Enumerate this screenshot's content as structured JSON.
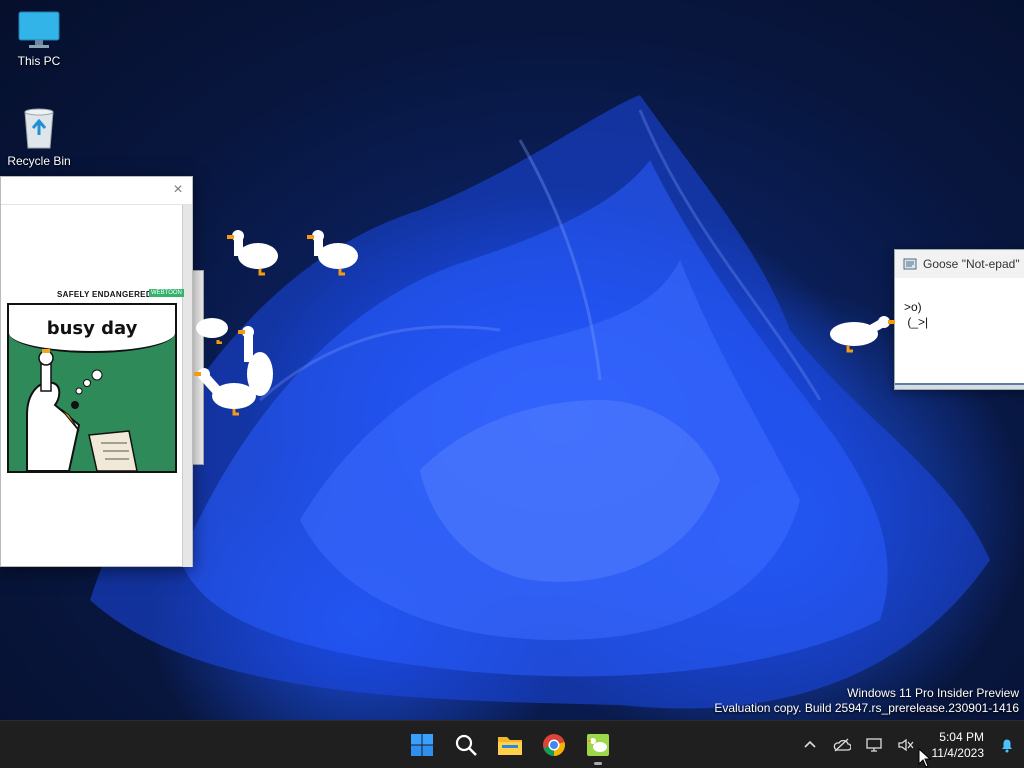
{
  "desktop": {
    "icons": [
      {
        "label": "This PC",
        "icon": "monitor-icon"
      },
      {
        "label": "Recycle Bin",
        "icon": "recycle-bin-icon"
      }
    ]
  },
  "comic_window": {
    "close_glyph": "×",
    "header": "SAFELY ENDANGERED",
    "badge": "WEBTOON",
    "caption": "busy day"
  },
  "notepad": {
    "title": "Goose \"Not-epad\"",
    "body": ">o)\n (_>|"
  },
  "watermark": {
    "line1": "Windows 11 Pro Insider Preview",
    "line2": "Evaluation copy. Build 25947.rs_prerelease.230901-1416"
  },
  "taskbar": {
    "apps": [
      "start-icon",
      "search-icon",
      "file-explorer-icon",
      "chrome-icon",
      "goose-app-icon"
    ],
    "tray": [
      "chevron-up-icon",
      "onedrive-icon",
      "network-icon",
      "volume-muted-icon"
    ],
    "time": "5:04 PM",
    "date": "11/4/2023"
  },
  "colors": {
    "accent": "#1745d6",
    "taskbar": "#1f1f1f",
    "comic_green": "#2f8a5a"
  }
}
